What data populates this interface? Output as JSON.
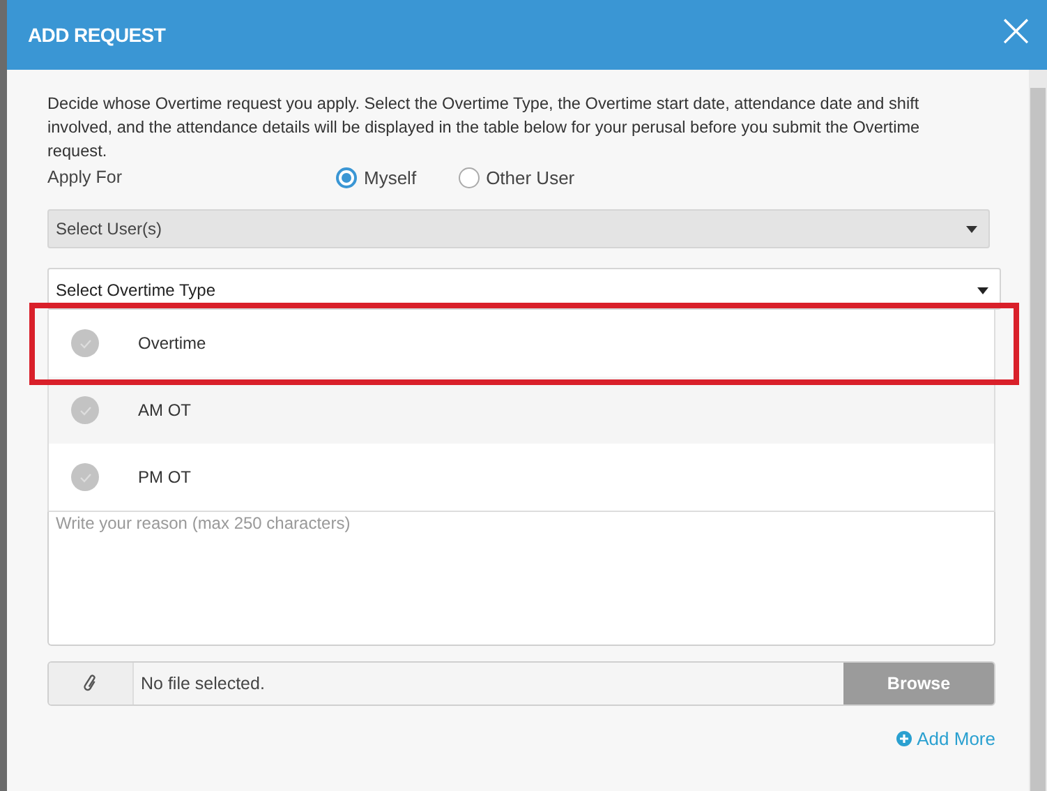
{
  "dialog": {
    "title": "ADD REQUEST",
    "close": "×"
  },
  "description": "Decide whose Overtime request you apply. Select the Overtime Type, the Overtime start date, attendance date and shift involved, and the attendance details will be displayed in the table below for your perusal before you submit the Overtime request.",
  "apply_for": {
    "label": "Apply For",
    "options": [
      {
        "label": "Myself",
        "selected": true
      },
      {
        "label": "Other User",
        "selected": false
      }
    ]
  },
  "user_select": {
    "placeholder": "Select User(s)",
    "disabled": true
  },
  "overtime_type": {
    "placeholder": "Select Overtime Type",
    "expanded": true,
    "options": [
      {
        "label": "Overtime",
        "checked": false,
        "highlighted": true
      },
      {
        "label": "AM OT",
        "checked": false,
        "highlighted": false
      },
      {
        "label": "PM OT",
        "checked": false,
        "highlighted": false
      }
    ]
  },
  "reason": {
    "placeholder": "Write your reason (max 250 characters)"
  },
  "attachment": {
    "value": "No file selected.",
    "button": "Browse"
  },
  "add_more": "Add More"
}
